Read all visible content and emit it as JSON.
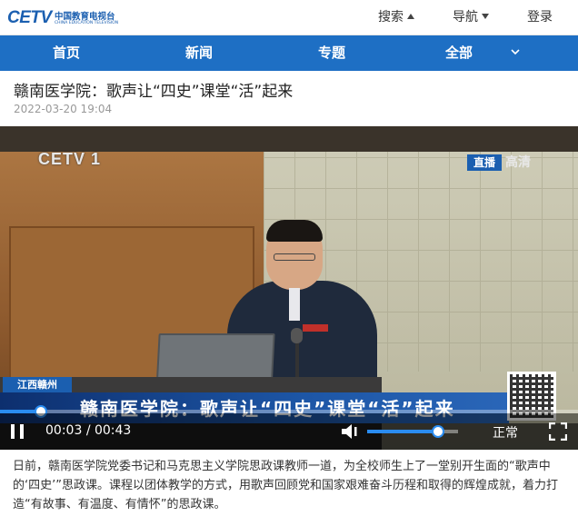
{
  "brand": {
    "logo_text": "CETV",
    "logo_cn": "中国教育电视台",
    "logo_en": "CHINA EDUCATION TELEVISION"
  },
  "topnav": {
    "search": "搜索",
    "nav": "导航",
    "login": "登录"
  },
  "mainnav": {
    "items": [
      "首页",
      "新闻",
      "专题",
      "全部"
    ]
  },
  "article": {
    "title": "赣南医学院：歌声让“四史”课堂“活”起来",
    "date": "2022-03-20 19:04",
    "body": "日前，赣南医学院党委书记和马克思主义学院思政课教师一道，为全校师生上了一堂别开生面的“歌声中的‘四史’”思政课。课程以团体教学的方式，用歌声回顾党和国家艰难奋斗历程和取得的辉煌成就，着力打造“有故事、有温度、有情怀”的思政课。"
  },
  "video": {
    "channel_logo": "CETV 1",
    "live_tag": "直播",
    "hd_tag": "高清",
    "location_tag": "江西赣州",
    "caption": "赣南医学院：歌声让“四史”课堂“活”起来"
  },
  "player": {
    "current_time": "00:03",
    "duration": "00:43",
    "time_separator": "/",
    "progress": 0.07,
    "volume": 0.78,
    "speed_label": "正常"
  },
  "colors": {
    "brand_blue": "#1e6fc4",
    "progress_blue": "#2a8cf0"
  },
  "icons": [
    "search-caret-icon",
    "nav-caret-icon",
    "chevron-down-icon",
    "pause-icon",
    "volume-icon",
    "fullscreen-icon"
  ]
}
